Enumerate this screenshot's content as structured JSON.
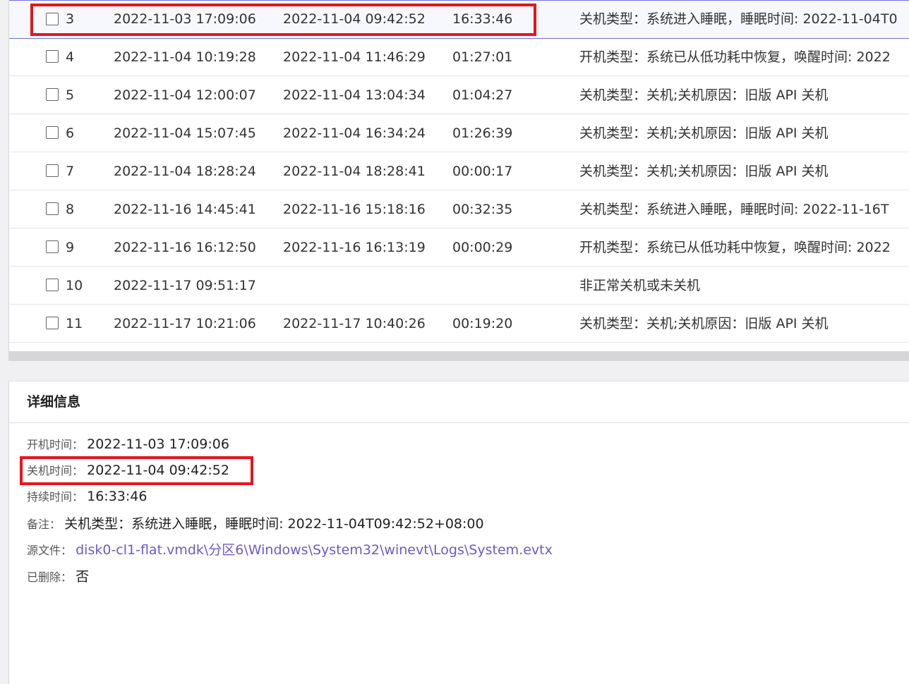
{
  "table": {
    "rows": [
      {
        "num": "3",
        "start": "2022-11-03 17:09:06",
        "end": "2022-11-04 09:42:52",
        "duration": "16:33:46",
        "note": "关机类型：系统进入睡眠，睡眠时间: 2022-11-04T0"
      },
      {
        "num": "4",
        "start": "2022-11-04 10:19:28",
        "end": "2022-11-04 11:46:29",
        "duration": "01:27:01",
        "note": "开机类型：系统已从低功耗中恢复，唤醒时间: 2022"
      },
      {
        "num": "5",
        "start": "2022-11-04 12:00:07",
        "end": "2022-11-04 13:04:34",
        "duration": "01:04:27",
        "note": "关机类型：关机;关机原因：旧版 API 关机"
      },
      {
        "num": "6",
        "start": "2022-11-04 15:07:45",
        "end": "2022-11-04 16:34:24",
        "duration": "01:26:39",
        "note": "关机类型：关机;关机原因：旧版 API 关机"
      },
      {
        "num": "7",
        "start": "2022-11-04 18:28:24",
        "end": "2022-11-04 18:28:41",
        "duration": "00:00:17",
        "note": "关机类型：关机;关机原因：旧版 API 关机"
      },
      {
        "num": "8",
        "start": "2022-11-16 14:45:41",
        "end": "2022-11-16 15:18:16",
        "duration": "00:32:35",
        "note": "关机类型：系统进入睡眠，睡眠时间: 2022-11-16T"
      },
      {
        "num": "9",
        "start": "2022-11-16 16:12:50",
        "end": "2022-11-16 16:13:19",
        "duration": "00:00:29",
        "note": "开机类型：系统已从低功耗中恢复，唤醒时间: 2022"
      },
      {
        "num": "10",
        "start": "2022-11-17 09:51:17",
        "end": "",
        "duration": "",
        "note": "非正常关机或未关机"
      },
      {
        "num": "11",
        "start": "2022-11-17 10:21:06",
        "end": "2022-11-17 10:40:26",
        "duration": "00:19:20",
        "note": "关机类型：关机;关机原因：旧版 API 关机"
      }
    ]
  },
  "detail": {
    "title": "详细信息",
    "start_label": "开机时间：",
    "start_value": "2022-11-03 17:09:06",
    "end_label": "关机时间：",
    "end_value": "2022-11-04 09:42:52",
    "duration_label": "持续时间：",
    "duration_value": "16:33:46",
    "note_label": "备注：",
    "note_value": "关机类型：系统进入睡眠，睡眠时间: 2022-11-04T09:42:52+08:00",
    "source_label": "源文件：",
    "source_value": "disk0-cl1-flat.vmdk\\分区6\\Windows\\System32\\winevt\\Logs\\System.evtx",
    "deleted_label": "已删除：",
    "deleted_value": "否"
  },
  "colors": {
    "highlight": "#e8141b",
    "selection_border": "#6f6fe0",
    "link": "#6a5acd"
  }
}
